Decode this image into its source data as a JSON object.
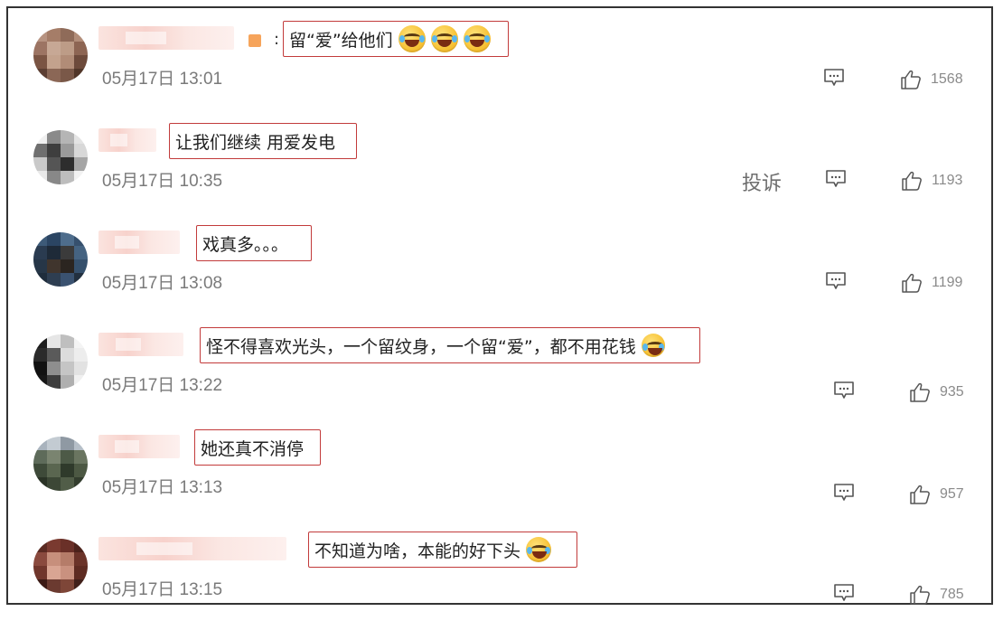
{
  "comments": [
    {
      "text": "留“爱”给他们",
      "time": "05月17日 13:01",
      "likes": "1568",
      "emoji": [
        "laugh-cry-emoji",
        "laugh-cry-emoji",
        "laugh-cry-emoji"
      ]
    },
    {
      "text": "让我们继续 用爱发电",
      "time": "05月17日 10:35",
      "likes": "1193",
      "report_label": "投诉"
    },
    {
      "text": "戏真多。。。",
      "time": "05月17日 13:08",
      "likes": "1199"
    },
    {
      "text": "怪不得喜欢光头，一个留纹身，一个留“爱”，都不用花钱",
      "time": "05月17日 13:22",
      "likes": "935",
      "emoji": [
        "laugh-cry-emoji"
      ]
    },
    {
      "text": "她还真不消停",
      "time": "05月17日 13:13",
      "likes": "957"
    },
    {
      "text": "不知道为啥，本能的好下头",
      "time": "05月17日 13:15",
      "likes": "785",
      "emoji": [
        "crying-emoji"
      ]
    }
  ],
  "colon": ":",
  "colors": {
    "highlight_border": "#c23b3b",
    "timestamp": "#7a7a7a",
    "name_blur": "#f7d2cc"
  },
  "icons": {
    "comment": "comment-bubble-icon",
    "like": "thumbs-up-icon"
  }
}
